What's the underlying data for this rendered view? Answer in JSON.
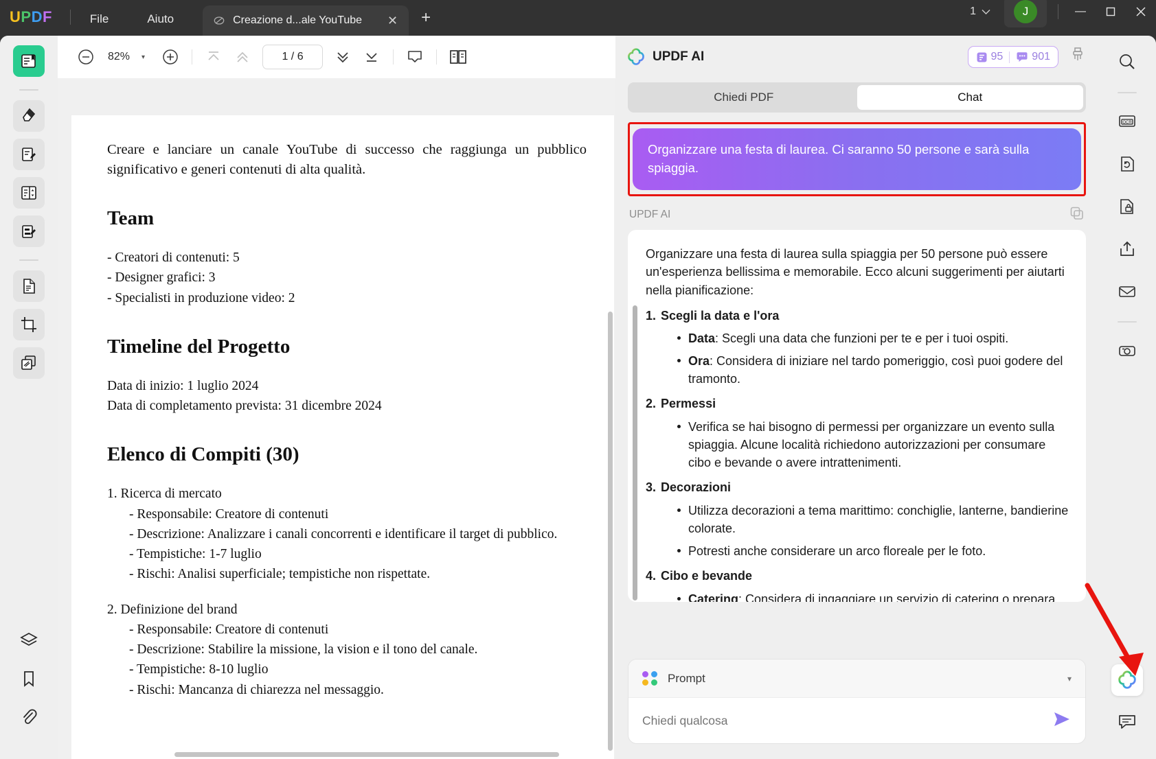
{
  "titlebar": {
    "logo": [
      "U",
      "P",
      "D",
      "F"
    ],
    "menus": [
      "File",
      "Aiuto"
    ],
    "tab_title": "Creazione d...ale YouTube",
    "tab_close": "✕",
    "new_tab": "+",
    "window_count": "1",
    "avatar_initial": "J",
    "minimize": "—",
    "maximize": "◻",
    "close": "✕"
  },
  "pdf_toolbar": {
    "zoom_out": "−",
    "zoom_value": "82%",
    "zoom_caret": "▾",
    "zoom_in": "+",
    "page_indicator": "1 / 6"
  },
  "left_rail": {
    "items": [
      {
        "name": "reader-view",
        "active": true
      },
      {
        "name": "highlighter-tool",
        "active": false
      },
      {
        "name": "annotate-tool",
        "active": false
      },
      {
        "name": "organize-pages-tool",
        "active": false
      },
      {
        "name": "edit-pdf-tool",
        "active": false
      },
      {
        "name": "convert-tool",
        "active": false
      },
      {
        "name": "crop-tool",
        "active": false
      },
      {
        "name": "page-stack-tool",
        "active": false
      }
    ],
    "bottom_items": [
      "layers-icon",
      "bookmark-icon",
      "attachment-icon"
    ]
  },
  "right_rail": {
    "items": [
      "search-icon",
      "ocr-icon",
      "convert-file-icon",
      "protect-icon",
      "share-icon",
      "email-icon",
      "compress-icon"
    ],
    "bottom_items": [
      "updf-ai-icon",
      "comment-icon"
    ]
  },
  "document": {
    "intro": "Creare e lanciare un canale YouTube di successo che raggiunga un pubblico significativo e generi contenuti di alta qualità.",
    "sections": [
      {
        "heading": "Team",
        "lines": [
          "- Creatori di contenuti: 5",
          "- Designer grafici: 3",
          "- Specialisti in produzione video: 2"
        ]
      },
      {
        "heading": "Timeline del Progetto",
        "lines": [
          "Data di inizio: 1 luglio 2024",
          "Data di completamento prevista: 31 dicembre 2024"
        ]
      },
      {
        "heading": "Elenco di Compiti (30)",
        "tasks": [
          {
            "title": "1. Ricerca di mercato",
            "details": [
              "- Responsabile: Creatore di contenuti",
              "- Descrizione: Analizzare i canali concorrenti e identificare il target di pubblico.",
              "- Tempistiche: 1-7 luglio",
              "- Rischi: Analisi superficiale; tempistiche non rispettate."
            ]
          },
          {
            "title": "2. Definizione del brand",
            "details": [
              "- Responsabile: Creatore di contenuti",
              "- Descrizione: Stabilire la missione, la vision e il tono del canale.",
              "- Tempistiche: 8-10 luglio",
              "- Rischi: Mancanza di chiarezza nel messaggio."
            ]
          }
        ]
      }
    ]
  },
  "ai_panel": {
    "title": "UPDF AI",
    "badge_doc_count": "95",
    "badge_chat_count": "901",
    "tabs": [
      {
        "label": "Chiedi PDF",
        "selected": false
      },
      {
        "label": "Chat",
        "selected": true
      }
    ],
    "user_message": "Organizzare una festa di laurea. Ci saranno 50 persone e sarà sulla spiaggia.",
    "ai_label": "UPDF AI",
    "ai_intro": "Organizzare una festa di laurea sulla spiaggia per 50 persone può essere un'esperienza bellissima e memorabile. Ecco alcuni suggerimenti per aiutarti nella pianificazione:",
    "ai_items": [
      {
        "num": "1.",
        "heading": "Scegli la data e l'ora",
        "bullets": [
          {
            "bold": "Data",
            "text": ": Scegli una data che funzioni per te e per i tuoi ospiti."
          },
          {
            "bold": "Ora",
            "text": ": Considera di iniziare nel tardo pomeriggio, così puoi godere del tramonto."
          }
        ]
      },
      {
        "num": "2.",
        "heading": "Permessi",
        "bullets": [
          {
            "bold": "",
            "text": "Verifica se hai bisogno di permessi per organizzare un evento sulla spiaggia. Alcune località richiedono autorizzazioni per consumare cibo e bevande o avere intrattenimenti."
          }
        ]
      },
      {
        "num": "3.",
        "heading": "Decorazioni",
        "bullets": [
          {
            "bold": "",
            "text": "Utilizza decorazioni a tema marittimo: conchiglie, lanterne, bandierine colorate."
          },
          {
            "bold": "",
            "text": "Potresti anche considerare un arco floreale per le foto."
          }
        ]
      },
      {
        "num": "4.",
        "heading": "Cibo e bevande",
        "bullets": [
          {
            "bold": "Catering",
            "text": ": Considera di ingaggiare un servizio di catering o prepara un buffet con cibi leggeri e freschi (insalate, finger food)."
          }
        ]
      }
    ],
    "prompt_label": "Prompt",
    "prompt_caret": "▾",
    "input_placeholder": "Chiedi qualcosa",
    "input_value": ""
  },
  "colors": {
    "accent_purple": "#8d7bf0",
    "badge_border": "#c9a9f5",
    "active_green": "#29cc8f",
    "highlight_red": "#e8150f",
    "titlebar_bg": "#323232"
  }
}
